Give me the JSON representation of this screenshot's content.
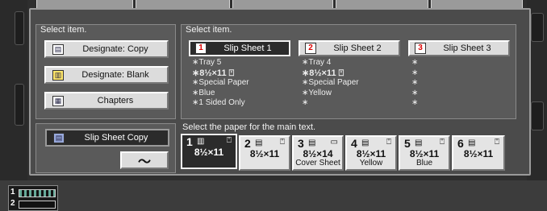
{
  "left": {
    "header": "Select item.",
    "buttons": [
      {
        "label": "Designate: Copy",
        "icon": "copy-icon",
        "glyph": "▤"
      },
      {
        "label": "Designate: Blank",
        "icon": "blank-icon",
        "glyph": "▥"
      },
      {
        "label": "Chapters",
        "icon": "chapters-icon",
        "glyph": "▦"
      }
    ],
    "slip_copy": {
      "label": "Slip Sheet Copy",
      "icon": "slip-copy-icon",
      "glyph": "▤"
    },
    "wave_symbol": "〜"
  },
  "right": {
    "header": "Select item.",
    "slips": [
      {
        "num": "1",
        "label": "Slip Sheet 1",
        "selected": true,
        "lines": [
          "∗Tray 5",
          "∗8½×11 ⍞",
          "∗Special Paper",
          "∗Blue",
          "∗1 Sided Only"
        ]
      },
      {
        "num": "2",
        "label": "Slip Sheet 2",
        "selected": false,
        "lines": [
          "∗Tray 4",
          "∗8½×11 ⍞",
          "∗Special Paper",
          "∗Yellow",
          "∗"
        ]
      },
      {
        "num": "3",
        "label": "Slip Sheet 3",
        "selected": false,
        "lines": [
          "∗",
          "∗",
          "∗",
          "∗",
          "∗"
        ]
      }
    ],
    "main_text_label": "Select the paper for the main text.",
    "papers": [
      {
        "num": "1",
        "glyph": "▥",
        "dir": "⍞",
        "size": "8½×11",
        "type": "",
        "selected": true
      },
      {
        "num": "2",
        "glyph": "▤",
        "dir": "⍞",
        "size": "8½×11",
        "type": "",
        "selected": false
      },
      {
        "num": "3",
        "glyph": "▤",
        "dir": "▭",
        "size": "8½×14",
        "type": "Cover Sheet",
        "selected": false
      },
      {
        "num": "4",
        "glyph": "▤",
        "dir": "⍞",
        "size": "8½×11",
        "type": "Yellow",
        "selected": false
      },
      {
        "num": "5",
        "glyph": "▤",
        "dir": "⍞",
        "size": "8½×11",
        "type": "Blue",
        "selected": false
      },
      {
        "num": "6",
        "glyph": "▤",
        "dir": "⍞",
        "size": "8½×11",
        "type": "",
        "selected": false
      }
    ]
  },
  "status": {
    "line1": "1",
    "line2": "2"
  }
}
